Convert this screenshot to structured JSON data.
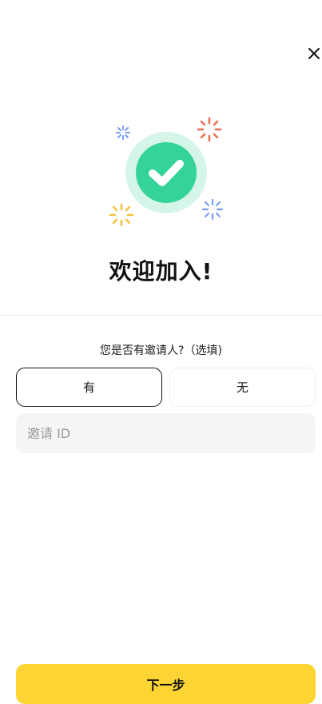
{
  "close": {
    "icon": "close-icon"
  },
  "hero": {
    "icon": "success-check-icon",
    "colors": {
      "ring": "#d6f5e9",
      "check_bg": "#34d399",
      "sparkle_blue": "#7b9cf5",
      "sparkle_orange": "#f26b4f",
      "sparkle_yellow": "#f5c33b"
    }
  },
  "title": "欢迎加入!",
  "invite": {
    "question": "您是否有邀请人?（选填)",
    "options": [
      {
        "label": "有",
        "selected": true
      },
      {
        "label": "无",
        "selected": false
      }
    ],
    "input_placeholder": "邀请 ID",
    "input_value": ""
  },
  "footer": {
    "next_label": "下一步",
    "accent_color": "#fcd535"
  }
}
